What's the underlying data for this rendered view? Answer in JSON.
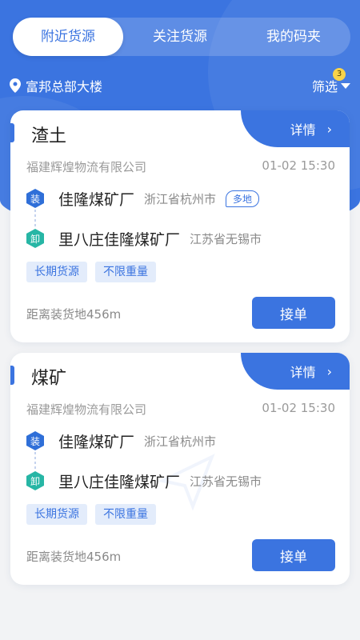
{
  "header": {
    "tabs": [
      {
        "label": "附近货源",
        "active": true
      },
      {
        "label": "关注货源",
        "active": false
      },
      {
        "label": "我的码夹",
        "active": false
      }
    ],
    "location": "富邦总部大楼",
    "filter_label": "筛选",
    "filter_badge": "3"
  },
  "cards": [
    {
      "title": "渣土",
      "detail_label": "详情",
      "company": "福建辉煌物流有限公司",
      "time": "01-02 15:30",
      "load_icon": "装",
      "load_place": "佳隆煤矿厂",
      "load_city": "浙江省杭州市",
      "multi_label": "多地",
      "unload_icon": "卸",
      "unload_place": "里八庄佳隆煤矿厂",
      "unload_city": "江苏省无锡市",
      "tags": [
        "长期货源",
        "不限重量"
      ],
      "distance": "距离装货地456m",
      "accept_label": "接单"
    },
    {
      "title": "煤矿",
      "detail_label": "详情",
      "company": "福建辉煌物流有限公司",
      "time": "01-02 15:30",
      "load_icon": "装",
      "load_place": "佳隆煤矿厂",
      "load_city": "浙江省杭州市",
      "unload_icon": "卸",
      "unload_place": "里八庄佳隆煤矿厂",
      "unload_city": "江苏省无锡市",
      "tags": [
        "长期货源",
        "不限重量"
      ],
      "distance": "距离装货地456m",
      "accept_label": "接单"
    }
  ],
  "colors": {
    "primary": "#3b74e0",
    "unload_icon": "#27b6a5",
    "badge": "#f8d34a",
    "background": "#f2f3f5"
  },
  "icons": [
    "location-pin-icon",
    "caret-down-icon",
    "chevron-right-icon",
    "load-hex-icon",
    "unload-hex-icon",
    "send-watermark-icon"
  ]
}
